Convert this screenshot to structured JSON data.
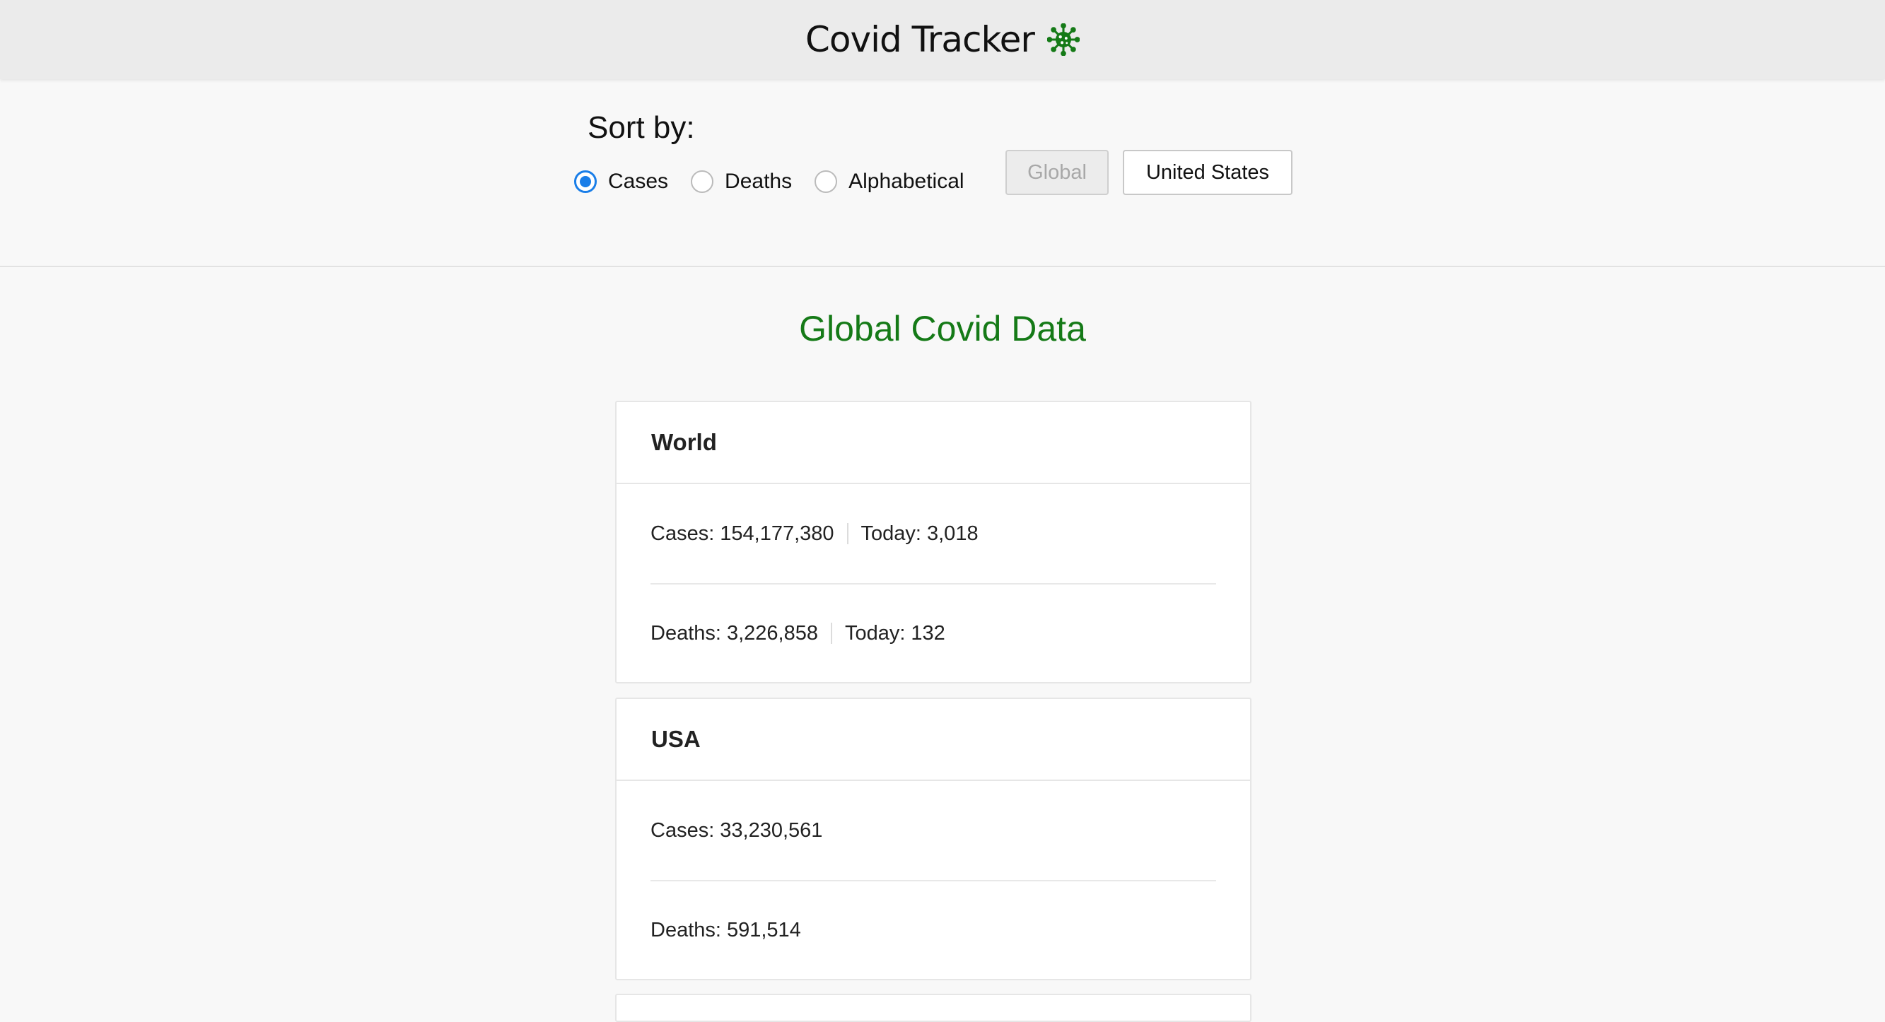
{
  "header": {
    "title": "Covid Tracker",
    "icon": "virus-icon",
    "icon_color": "#157a17"
  },
  "controls": {
    "sort_label": "Sort by:",
    "sort_options": [
      {
        "label": "Cases",
        "checked": true
      },
      {
        "label": "Deaths",
        "checked": false
      },
      {
        "label": "Alphabetical",
        "checked": false
      }
    ],
    "scope_buttons": [
      {
        "label": "Global",
        "disabled": true
      },
      {
        "label": "United States",
        "disabled": false
      }
    ]
  },
  "main": {
    "title": "Global Covid Data",
    "title_color": "#157a17",
    "cards": [
      {
        "name": "World",
        "cases_label": "Cases:",
        "cases": "154,177,380",
        "cases_today_label": "Today:",
        "cases_today": "3,018",
        "deaths_label": "Deaths:",
        "deaths": "3,226,858",
        "deaths_today_label": "Today:",
        "deaths_today": "132"
      },
      {
        "name": "USA",
        "cases_label": "Cases:",
        "cases": "33,230,561",
        "deaths_label": "Deaths:",
        "deaths": "591,514"
      }
    ]
  }
}
